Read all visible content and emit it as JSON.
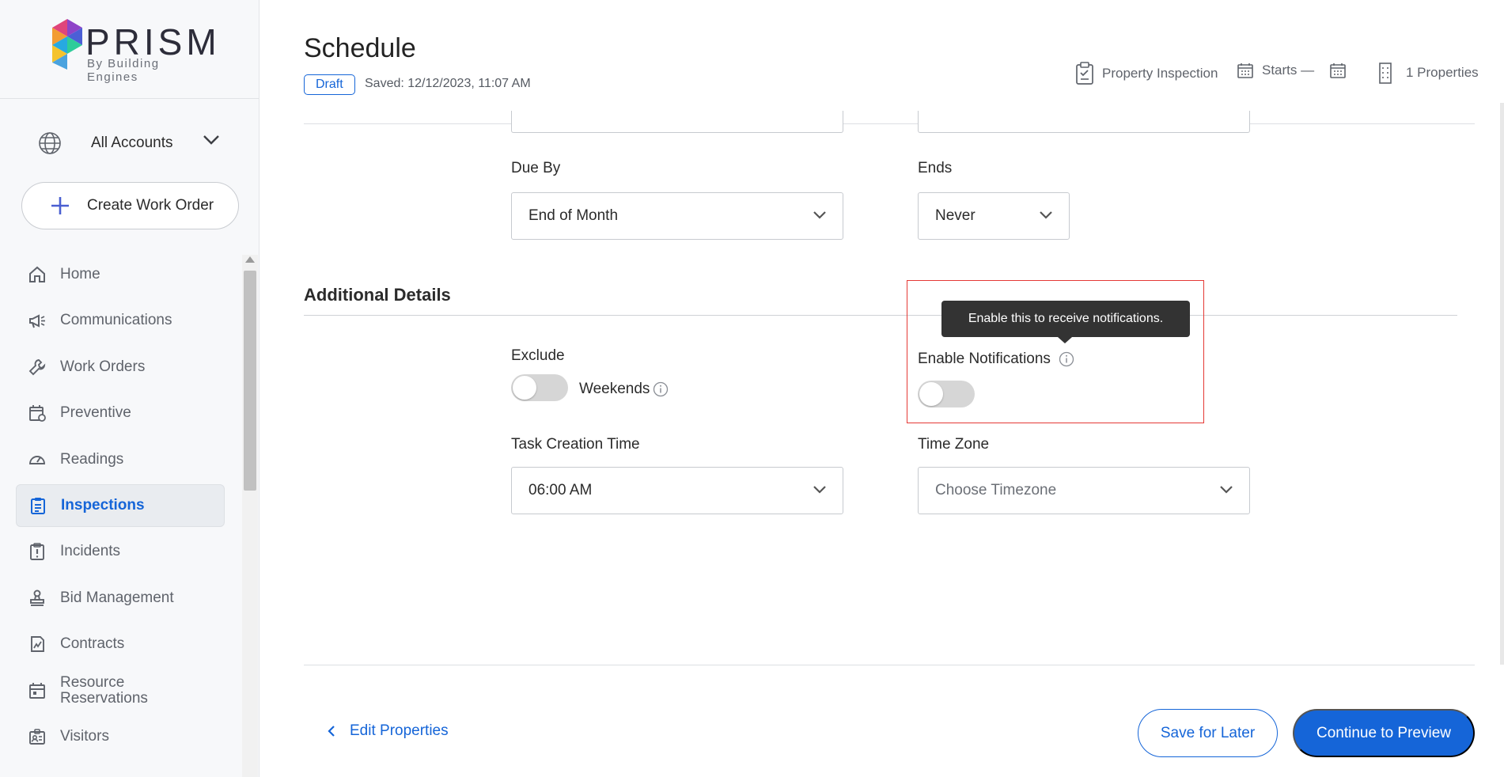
{
  "brand": {
    "name": "PRISM",
    "tagline": "By Building Engines"
  },
  "sidebar": {
    "account_selector": {
      "label": "All Accounts",
      "icon": "globe-icon"
    },
    "create_button": {
      "label": "Create Work Order",
      "icon": "plus-icon"
    },
    "items": [
      {
        "label": "Home",
        "icon": "home-icon",
        "active": false
      },
      {
        "label": "Communications",
        "icon": "megaphone-icon",
        "active": false
      },
      {
        "label": "Work Orders",
        "icon": "wrench-icon",
        "active": false
      },
      {
        "label": "Preventive",
        "icon": "calendar-refresh-icon",
        "active": false
      },
      {
        "label": "Readings",
        "icon": "gauge-icon",
        "active": false
      },
      {
        "label": "Inspections",
        "icon": "clipboard-icon",
        "active": true
      },
      {
        "label": "Incidents",
        "icon": "alert-clipboard-icon",
        "active": false
      },
      {
        "label": "Bid Management",
        "icon": "stamp-icon",
        "active": false
      },
      {
        "label": "Contracts",
        "icon": "contract-icon",
        "active": false
      },
      {
        "label": "Resource Reservations",
        "icon": "calendar-icon",
        "active": false
      },
      {
        "label": "Visitors",
        "icon": "badge-icon",
        "active": false
      }
    ]
  },
  "header": {
    "title": "Schedule",
    "status_badge": "Draft",
    "saved_text": "Saved: 12/12/2023, 11:07 AM",
    "meta": {
      "inspection_type": "Property Inspection",
      "starts": "Starts —",
      "properties": "1 Properties"
    }
  },
  "form": {
    "due_by": {
      "label": "Due By",
      "value": "End of Month"
    },
    "ends": {
      "label": "Ends",
      "value": "Never"
    },
    "additional_details": {
      "title": "Additional Details",
      "exclude": {
        "label": "Exclude",
        "toggle_label": "Weekends",
        "enabled": false
      },
      "notifications": {
        "label": "Enable Notifications",
        "enabled": false,
        "tooltip": "Enable this to receive notifications."
      },
      "task_creation_time": {
        "label": "Task Creation Time",
        "value": "06:00 AM"
      },
      "time_zone": {
        "label": "Time Zone",
        "placeholder": "Choose Timezone"
      }
    }
  },
  "footer": {
    "back_link": "Edit Properties",
    "save_later": "Save for Later",
    "continue": "Continue to Preview"
  },
  "colors": {
    "accent": "#1565d8",
    "highlight": "#e53935",
    "tooltip_bg": "#333333",
    "sidebar_bg": "#f7f8fa"
  }
}
